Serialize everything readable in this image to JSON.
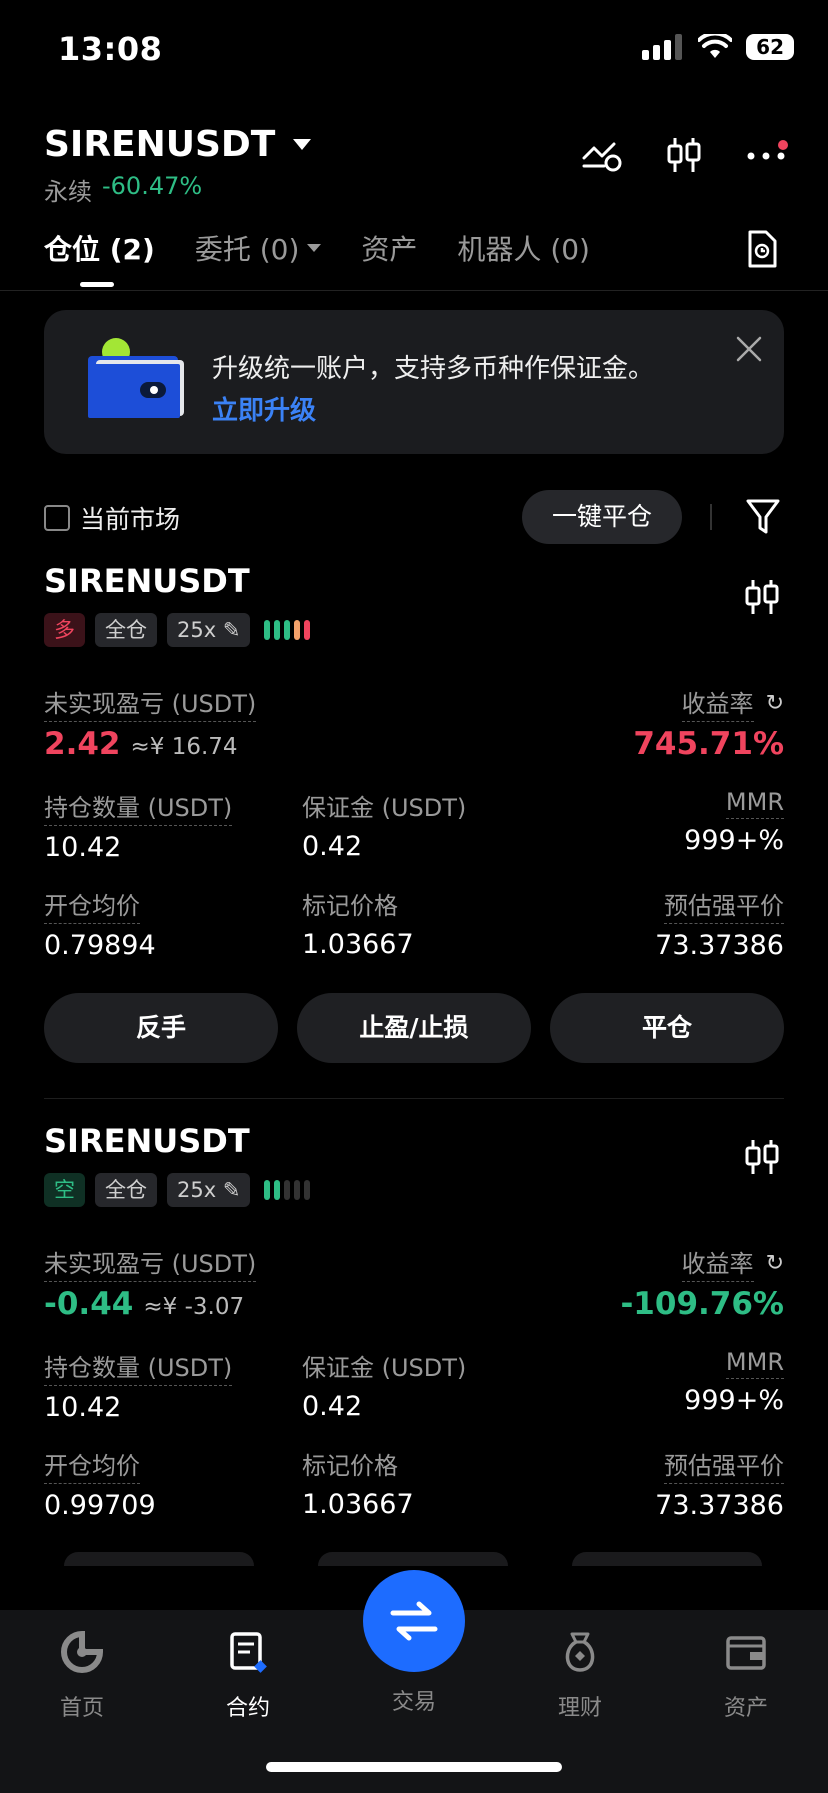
{
  "status_bar": {
    "time": "13:08",
    "battery": "62"
  },
  "header": {
    "pair": "SIRENUSDT",
    "contract_type": "永续",
    "change": "-60.47%"
  },
  "tabs": [
    {
      "label": "仓位 (2)"
    },
    {
      "label": "委托 (0)"
    },
    {
      "label": "资产"
    },
    {
      "label": "机器人 (0)"
    }
  ],
  "banner": {
    "text": "升级统一账户，支持多币种作保证金。",
    "link": "立即升级"
  },
  "filter": {
    "current_market_label": "当前市场",
    "close_all_label": "一键平仓"
  },
  "positions": [
    {
      "symbol": "SIRENUSDT",
      "side_tag": "多",
      "margin_mode": "全仓",
      "leverage": "25x",
      "unrealized_pnl_label": "未实现盈亏 (USDT)",
      "unrealized_pnl": "2.42",
      "pnl_cny": "≈¥ 16.74",
      "roe_label": "收益率",
      "roe": "745.71%",
      "size_label": "持仓数量 (USDT)",
      "size": "10.42",
      "margin_label": "保证金 (USDT)",
      "margin": "0.42",
      "mmr_label": "MMR",
      "mmr": "999+%",
      "entry_label": "开仓均价",
      "entry_price": "0.79894",
      "mark_label": "标记价格",
      "mark_price": "1.03667",
      "liq_label": "预估强平价",
      "liq_price": "73.37386",
      "btn_reverse": "反手",
      "btn_tpsl": "止盈/止损",
      "btn_close": "平仓"
    },
    {
      "symbol": "SIRENUSDT",
      "side_tag": "空",
      "margin_mode": "全仓",
      "leverage": "25x",
      "unrealized_pnl_label": "未实现盈亏 (USDT)",
      "unrealized_pnl": "-0.44",
      "pnl_cny": "≈¥ -3.07",
      "roe_label": "收益率",
      "roe": "-109.76%",
      "size_label": "持仓数量 (USDT)",
      "size": "10.42",
      "margin_label": "保证金 (USDT)",
      "margin": "0.42",
      "mmr_label": "MMR",
      "mmr": "999+%",
      "entry_label": "开仓均价",
      "entry_price": "0.99709",
      "mark_label": "标记价格",
      "mark_price": "1.03667",
      "liq_label": "预估强平价",
      "liq_price": "73.37386"
    }
  ],
  "bottom_nav": [
    {
      "label": "首页",
      "icon": "home-icon"
    },
    {
      "label": "合约",
      "icon": "futures-icon"
    },
    {
      "label": "交易",
      "icon": "swap-icon"
    },
    {
      "label": "理财",
      "icon": "earn-icon"
    },
    {
      "label": "资产",
      "icon": "wallet-icon"
    }
  ],
  "colors": {
    "up": "#2ebd85",
    "down": "#f0445e",
    "accent": "#1d6cff",
    "liq": "#f5a26b"
  }
}
